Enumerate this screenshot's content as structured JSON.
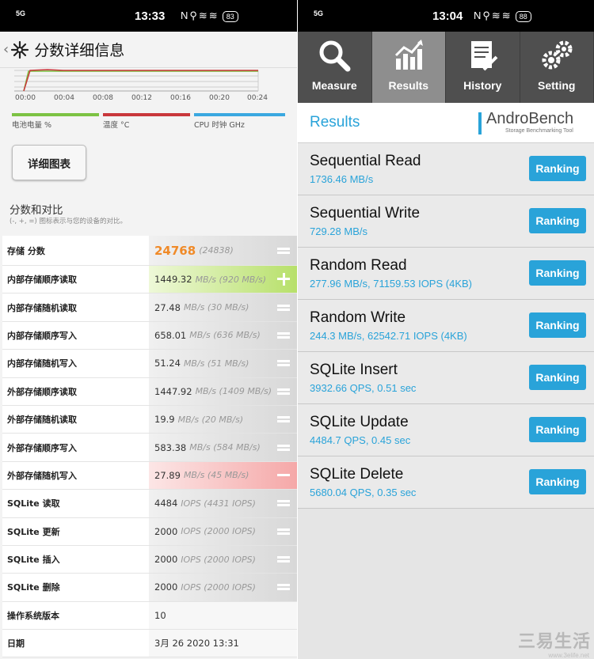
{
  "left": {
    "status": {
      "signal": "5G",
      "time": "13:33",
      "icons": "N⚲≋≋",
      "battery": "83"
    },
    "header": {
      "title": "分数详细信息"
    },
    "chart": {
      "x_ticks": [
        "00:00",
        "00:04",
        "00:08",
        "00:12",
        "00:16",
        "00:20",
        "00:24"
      ]
    },
    "legend": [
      {
        "label": "电池电量 %",
        "color": "#7cc243"
      },
      {
        "label": "温度 °C",
        "color": "#c9373b"
      },
      {
        "label": "CPU 时钟 GHz",
        "color": "#3aa8e0"
      }
    ],
    "detail_button": "详细图表",
    "section_title": "分数和对比",
    "section_sub": "(-, +, =) 图标表示与您的设备的对比。",
    "rows": [
      {
        "name": "存储 分数",
        "value": "24768",
        "unit": "(24838)",
        "style": "total",
        "icon": "equal-icon"
      },
      {
        "name": "内部存储顺序读取",
        "value": "1449.32",
        "unit": "MB/s (920 MB/s)",
        "style": "green",
        "icon": "plus-icon"
      },
      {
        "name": "内部存储随机读取",
        "value": "27.48",
        "unit": "MB/s (30 MB/s)",
        "style": "gray",
        "icon": "equal-icon"
      },
      {
        "name": "内部存储顺序写入",
        "value": "658.01",
        "unit": "MB/s (636 MB/s)",
        "style": "gray",
        "icon": "equal-icon"
      },
      {
        "name": "内部存储随机写入",
        "value": "51.24",
        "unit": "MB/s (51 MB/s)",
        "style": "gray",
        "icon": "equal-icon"
      },
      {
        "name": "外部存储顺序读取",
        "value": "1447.92",
        "unit": "MB/s (1409 MB/s)",
        "style": "gray",
        "icon": "equal-icon"
      },
      {
        "name": "外部存储随机读取",
        "value": "19.9",
        "unit": "MB/s (20 MB/s)",
        "style": "gray",
        "icon": "equal-icon"
      },
      {
        "name": "外部存储顺序写入",
        "value": "583.38",
        "unit": "MB/s (584 MB/s)",
        "style": "gray",
        "icon": "equal-icon"
      },
      {
        "name": "外部存储随机写入",
        "value": "27.89",
        "unit": "MB/s (45 MB/s)",
        "style": "red",
        "icon": "minus-icon"
      },
      {
        "name": "SQLite 读取",
        "value": "4484",
        "unit": "IOPS (4431 IOPS)",
        "style": "gray",
        "icon": "equal-icon"
      },
      {
        "name": "SQLite 更新",
        "value": "2000",
        "unit": "IOPS (2000 IOPS)",
        "style": "gray",
        "icon": "equal-icon"
      },
      {
        "name": "SQLite 插入",
        "value": "2000",
        "unit": "IOPS (2000 IOPS)",
        "style": "gray",
        "icon": "equal-icon"
      },
      {
        "name": "SQLite 删除",
        "value": "2000",
        "unit": "IOPS (2000 IOPS)",
        "style": "gray",
        "icon": "equal-icon"
      },
      {
        "name": "操作系统版本",
        "value": "10",
        "unit": "",
        "style": "plain",
        "icon": ""
      },
      {
        "name": "日期",
        "value": "3月 26 2020 13:31",
        "unit": "",
        "style": "plain",
        "icon": ""
      }
    ]
  },
  "right": {
    "status": {
      "signal": "5G",
      "time": "13:04",
      "icons": "N⚲≋≋",
      "battery": "88"
    },
    "tabs": [
      {
        "label": "Measure",
        "icon": "magnifier-icon",
        "active": false
      },
      {
        "label": "Results",
        "icon": "chart-icon",
        "active": true
      },
      {
        "label": "History",
        "icon": "document-icon",
        "active": false
      },
      {
        "label": "Setting",
        "icon": "gears-icon",
        "active": false
      }
    ],
    "results_title": "Results",
    "brand": {
      "name": "AndroBench",
      "tagline": "Storage Benchmarking Tool"
    },
    "ranking_label": "Ranking",
    "results": [
      {
        "name": "Sequential Read",
        "value": "1736.46 MB/s"
      },
      {
        "name": "Sequential Write",
        "value": "729.28 MB/s"
      },
      {
        "name": "Random Read",
        "value": "277.96 MB/s, 71159.53 IOPS (4KB)"
      },
      {
        "name": "Random Write",
        "value": "244.3 MB/s, 62542.71 IOPS (4KB)"
      },
      {
        "name": "SQLite Insert",
        "value": "3932.66 QPS, 0.51 sec"
      },
      {
        "name": "SQLite Update",
        "value": "4484.7 QPS, 0.45 sec"
      },
      {
        "name": "SQLite Delete",
        "value": "5680.04 QPS, 0.35 sec"
      }
    ]
  },
  "watermark": {
    "text": "三易生活",
    "url": "www.3elife.net"
  }
}
